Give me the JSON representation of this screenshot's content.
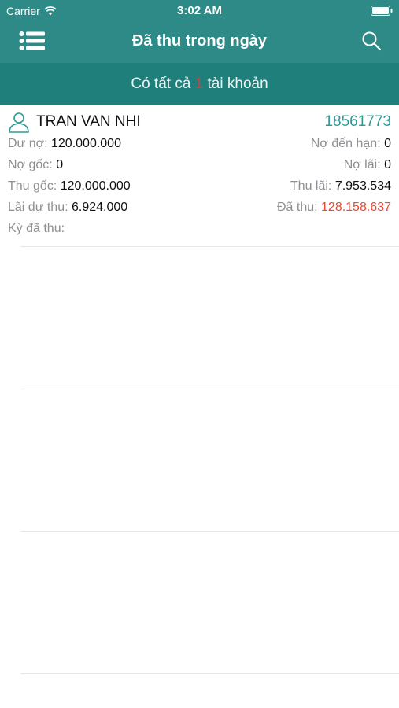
{
  "status_bar": {
    "carrier": "Carrier",
    "time": "3:02 AM"
  },
  "nav": {
    "title": "Đã thu trong ngày",
    "left_icon": "menu-list-icon",
    "right_icon": "search-icon"
  },
  "summary": {
    "prefix": "Có tất cả ",
    "count": "1",
    "suffix": " tài khoản"
  },
  "account": {
    "name": "TRAN VAN NHI",
    "number": "18561773",
    "rows": [
      {
        "left_label": "Dư nợ:",
        "left_value": "120.000.000",
        "right_label": "Nợ đến hạn:",
        "right_value": "0"
      },
      {
        "left_label": "Nợ gốc:",
        "left_value": "0",
        "right_label": "Nợ lãi:",
        "right_value": "0"
      },
      {
        "left_label": "Thu gốc:",
        "left_value": "120.000.000",
        "right_label": "Thu lãi:",
        "right_value": "7.953.534"
      },
      {
        "left_label": "Lãi dự thu:",
        "left_value": "6.924.000",
        "right_label": "Đã thu:",
        "right_value": "128.158.637"
      },
      {
        "left_label": "Kỳ đã thu:",
        "left_value": "",
        "right_label": "",
        "right_value": ""
      }
    ]
  },
  "colors": {
    "header": "#2e8a86",
    "summary_bar": "#1f7f7b",
    "account_number": "#2e9a95",
    "highlight_red": "#e8492f"
  }
}
